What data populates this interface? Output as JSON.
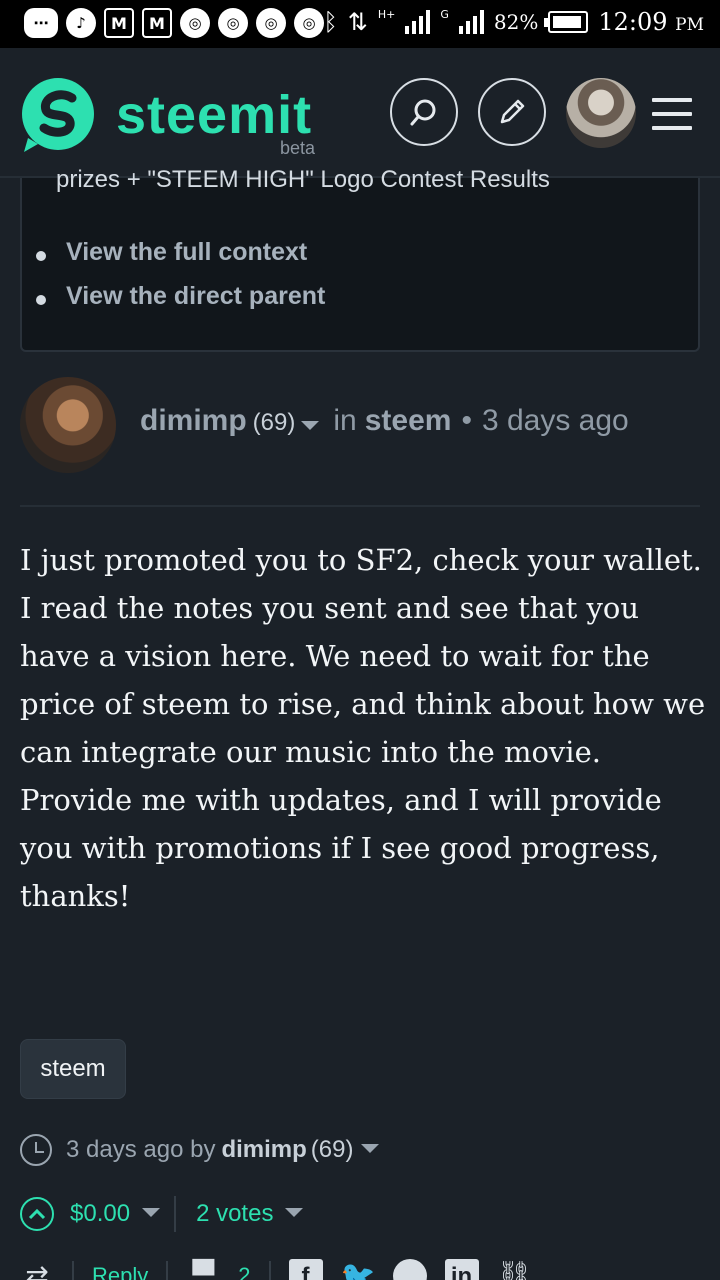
{
  "status_bar": {
    "left_icons": [
      "more-icon",
      "tiktok-icon",
      "gmail-icon",
      "gmail-icon",
      "chrome-icon",
      "chrome-icon",
      "chrome-icon",
      "chrome-icon"
    ],
    "network_label": "H+",
    "network_label2": "G",
    "battery_percent": "82%",
    "time": "12:09",
    "ampm": "PM"
  },
  "header": {
    "logo_text": "steemit",
    "logo_sub": "beta",
    "accent_color": "#2de0b0"
  },
  "context": {
    "cut_text": "prizes + \"STEEM HIGH\" Logo Contest Results",
    "links": [
      "View the full context",
      "View the direct parent"
    ]
  },
  "post": {
    "author": "dimimp",
    "reputation": "(69)",
    "in_label": "in",
    "category": "steem",
    "bullet": "•",
    "age": "3 days ago",
    "body": "I just promoted you to SF2, check your wallet. I read the notes you sent and see that you have a vision here. We need to wait for the price of steem to rise, and think about how we can integrate our music into the movie. Provide me with updates, and I will provide you with promotions if I see good progress, thanks!",
    "tag": "steem"
  },
  "footer": {
    "meta_prefix": "3 days ago by",
    "author": "dimimp",
    "reputation": "(69)",
    "payout": "$0.00",
    "votes": "2 votes",
    "reply_label": "Reply",
    "comment_count": "2"
  }
}
